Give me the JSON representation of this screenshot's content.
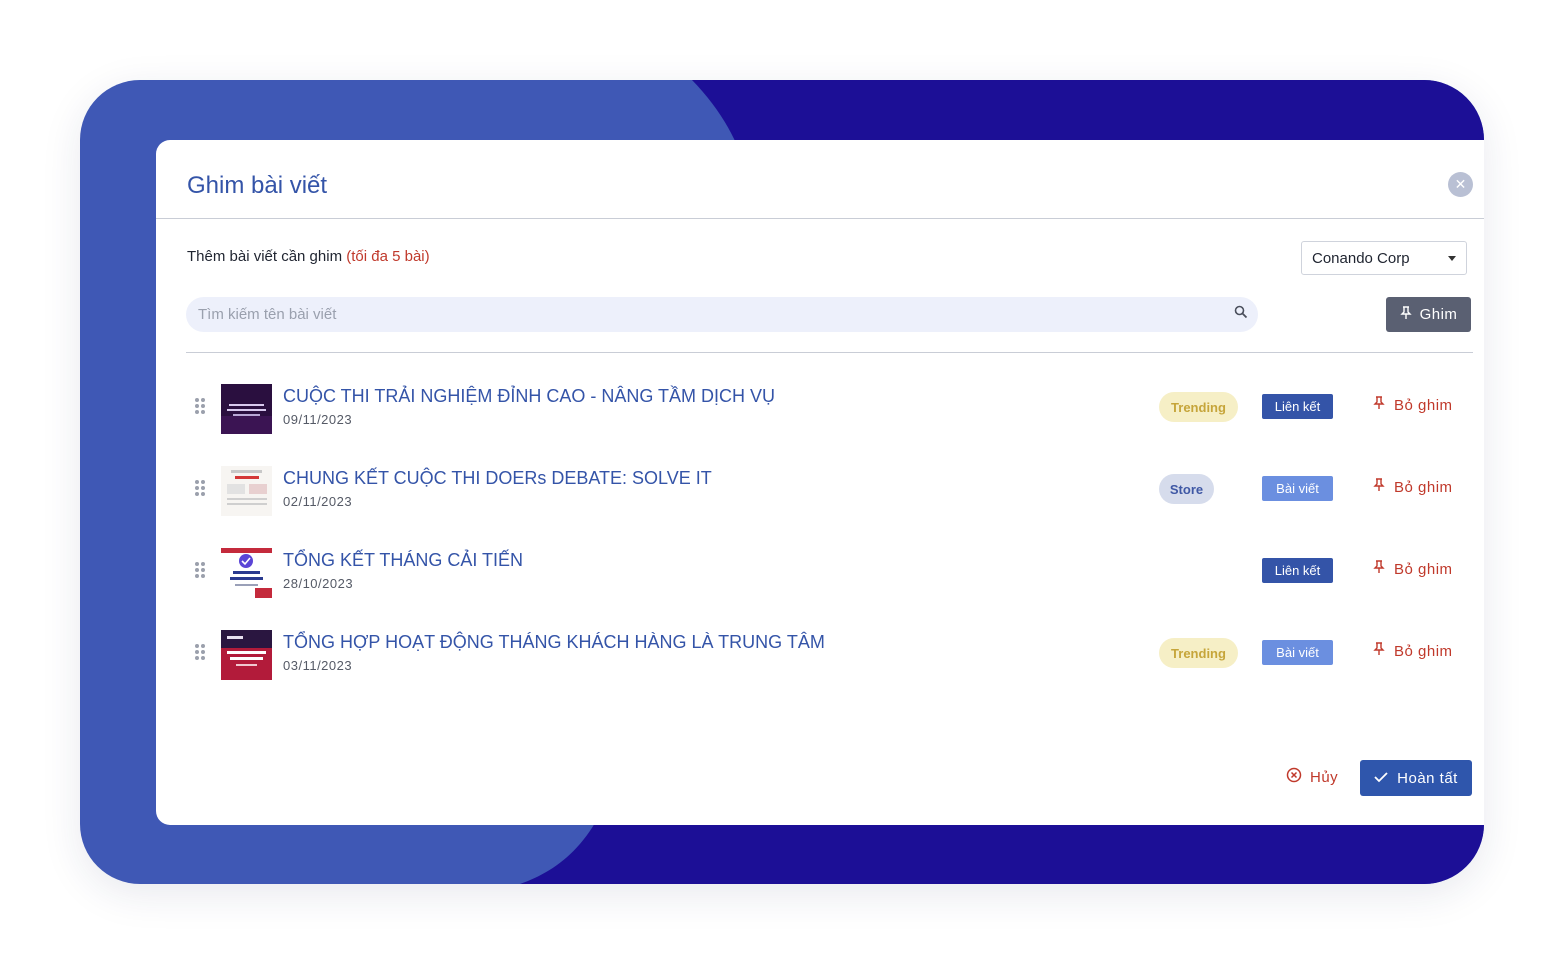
{
  "dialog": {
    "title": "Ghim bài viết",
    "subtitle": "Thêm bài viết cần ghim",
    "limit_note": "(tối đa 5 bài)"
  },
  "org_select": {
    "value": "Conando Corp"
  },
  "search": {
    "placeholder": "Tìm kiếm tên bài viết"
  },
  "pin_button": {
    "label": "Ghim"
  },
  "posts": [
    {
      "title": "CUỘC THI TRẢI NGHIỆM ĐỈNH CAO - NÂNG TẦM DỊCH VỤ",
      "date": "09/11/2023",
      "badge": "Trending",
      "type": "Liên kết",
      "unpin": "Bỏ ghim"
    },
    {
      "title": "CHUNG KẾT CUỘC THI DOERs DEBATE: SOLVE IT",
      "date": "02/11/2023",
      "badge": "Store",
      "type": "Bài viết",
      "unpin": "Bỏ ghim"
    },
    {
      "title": "TỔNG KẾT THÁNG CẢI TIẾN",
      "date": "28/10/2023",
      "badge": "",
      "type": "Liên kết",
      "unpin": "Bỏ ghim"
    },
    {
      "title": "TỔNG HỢP HOẠT ĐỘNG THÁNG KHÁCH HÀNG LÀ TRUNG TÂM",
      "date": "03/11/2023",
      "badge": "Trending",
      "type": "Bài viết",
      "unpin": "Bỏ ghim"
    }
  ],
  "footer": {
    "cancel_label": "Hủy",
    "done_label": "Hoàn tất"
  },
  "colors": {
    "background_blue": "#3f58b5",
    "background_navy": "#1c0f96",
    "title_blue": "#3454a8",
    "danger_red": "#c0392b",
    "trending_bg": "#f6efc6",
    "trending_text": "#c6a53a",
    "store_bg": "#d6dcec",
    "link_button": "#3454a8",
    "post_button": "#6b8fe0"
  },
  "icons": {
    "close": "close-icon",
    "caret": "chevron-down-icon",
    "search": "search-icon",
    "pin": "pin-icon",
    "drag": "drag-handle-icon",
    "cancel": "cancel-circle-icon",
    "check": "check-icon"
  }
}
